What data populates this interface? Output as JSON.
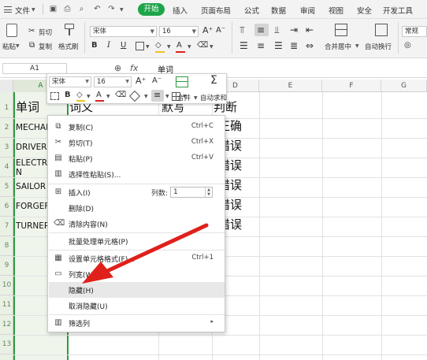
{
  "menubar": {
    "file": "文件",
    "start": "开始",
    "tabs": [
      "插入",
      "页面布局",
      "公式",
      "数据",
      "审阅",
      "视图",
      "安全",
      "开发工具"
    ]
  },
  "ribbon": {
    "paste": "粘贴",
    "cut": "剪切",
    "copy": "复制",
    "format_painter": "格式刷",
    "font": "宋体",
    "size": "16",
    "merge_center": "合并居中",
    "wrap_text": "自动换行",
    "number_format": "常规"
  },
  "formula_bar": {
    "name_box": "A1",
    "content": "单词"
  },
  "columns": [
    "A",
    "D",
    "E",
    "F",
    "G"
  ],
  "rows": [
    "1",
    "2",
    "3",
    "4",
    "5",
    "6",
    "7",
    "8",
    "9",
    "10",
    "11",
    "12",
    "13"
  ],
  "cells": {
    "a1": "单词",
    "b1": "词义",
    "c1": "默写",
    "d1": "判断",
    "a2": "MECHAN",
    "a3": "DRIVER",
    "a4_line1": "ELECTR",
    "a4_line2": "N",
    "a5": "SAILOR",
    "a6": "FORGEF",
    "a7": "TURNER",
    "d2": "正确",
    "d3": "错误",
    "d4": "错误",
    "d5": "错误",
    "d6": "错误",
    "d7": "错误"
  },
  "mini_toolbar": {
    "font": "宋体",
    "size": "16",
    "merge": "合并",
    "autosum": "自动求和"
  },
  "context_menu": {
    "copy": "复制(C)",
    "copy_sc": "Ctrl+C",
    "cut": "剪切(T)",
    "cut_sc": "Ctrl+X",
    "paste": "粘贴(P)",
    "paste_sc": "Ctrl+V",
    "paste_special": "选择性粘贴(S)...",
    "insert": "插入(I)",
    "col_count_label": "列数:",
    "col_count_value": "1",
    "delete": "删除(D)",
    "clear": "清除内容(N)",
    "batch": "批量处理单元格(P)",
    "format_cells": "设置单元格格式(F)...",
    "format_sc": "Ctrl+1",
    "col_width": "列宽(W)...",
    "hide": "隐藏(H)",
    "unhide": "取消隐藏(U)",
    "filter": "筛选列"
  },
  "colors": {
    "accent_green": "#1ea54b",
    "annotation_red": "#e0201b"
  }
}
